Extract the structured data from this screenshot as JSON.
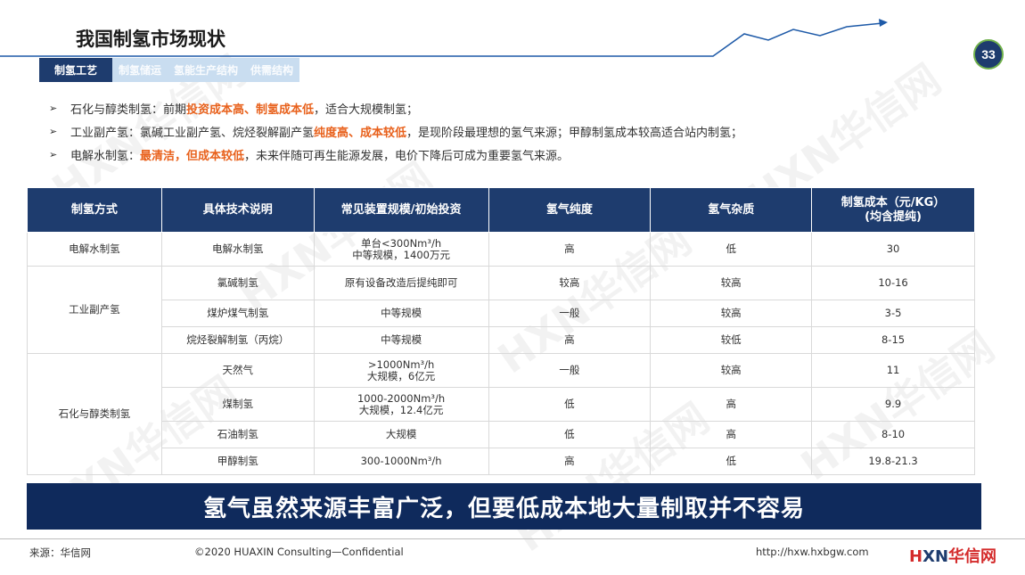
{
  "title": "我国制氢市场现状",
  "page_number": "33",
  "tabs": [
    {
      "label": "制氢工艺",
      "active": true
    },
    {
      "label": "制氢储运",
      "active": false
    },
    {
      "label": "氢能生产结构",
      "active": false
    },
    {
      "label": "供需结构",
      "active": false
    }
  ],
  "bullets": [
    {
      "pre": "石化与醇类制氢：前期",
      "hl1": "投资成本高、制氢成本低",
      "mid": "，适合大规模制氢；",
      "hl2": "",
      "post": ""
    },
    {
      "pre": "工业副产氢：氯碱工业副产氢、烷烃裂解副产氢",
      "hl1": "纯度高、成本较低",
      "mid": "，是现阶段最理想的氢气来源；甲醇制氢成本较高适合站内制氢；",
      "hl2": "",
      "post": ""
    },
    {
      "pre": "电解水制氢：",
      "hl1": "最清洁，但成本较低",
      "mid": "，未来伴随可再生能源发展，电价下降后可成为重要氢气来源。",
      "hl2": "",
      "post": ""
    }
  ],
  "table": {
    "headers": [
      "制氢方式",
      "具体技术说明",
      "常见装置规模/初始投资",
      "氢气纯度",
      "氢气杂质",
      "制氢成本（元/KG）",
      "(均含提纯)"
    ],
    "groups": [
      {
        "method": "电解水制氢",
        "rows": [
          {
            "tech": "电解水制氢",
            "scale1": "单台<300Nm³/h",
            "scale2": "中等规模，1400万元",
            "purity": "高",
            "impurity": "低",
            "cost": "30"
          }
        ]
      },
      {
        "method": "工业副产氢",
        "rows": [
          {
            "tech": "氯碱制氢",
            "scale1": "原有设备改造后提纯即可",
            "scale2": "",
            "purity": "较高",
            "impurity": "较高",
            "cost": "10-16"
          },
          {
            "tech": "煤炉煤气制氢",
            "scale1": "中等规模",
            "scale2": "",
            "purity": "一般",
            "impurity": "较高",
            "cost": "3-5"
          },
          {
            "tech": "烷烃裂解制氢（丙烷）",
            "scale1": "中等规模",
            "scale2": "",
            "purity": "高",
            "impurity": "较低",
            "cost": "8-15"
          }
        ]
      },
      {
        "method": "石化与醇类制氢",
        "rows": [
          {
            "tech": "天然气",
            "scale1": ">1000Nm³/h",
            "scale2": "大规模，6亿元",
            "purity": "一般",
            "impurity": "较高",
            "cost": "11"
          },
          {
            "tech": "煤制氢",
            "scale1": "1000-2000Nm³/h",
            "scale2": "大规模，12.4亿元",
            "purity": "低",
            "impurity": "高",
            "cost": "9.9"
          },
          {
            "tech": "石油制氢",
            "scale1": "大规模",
            "scale2": "",
            "purity": "低",
            "impurity": "高",
            "cost": "8-10"
          },
          {
            "tech": "甲醇制氢",
            "scale1": "300-1000Nm³/h",
            "scale2": "",
            "purity": "高",
            "impurity": "低",
            "cost": "19.8-21.3"
          }
        ]
      }
    ]
  },
  "banner": "氢气虽然来源丰富广泛，但要低成本地大量制取并不容易",
  "footer": {
    "source": "来源：华信网",
    "copyright": "©2020 HUAXIN Consulting—Confidential",
    "url": "http://hxw.hxbgw.com",
    "logo_h": "H",
    "logo_xn": "XN",
    "logo_cn": "华信网"
  },
  "colors": {
    "navy": "#1e3c6e",
    "orange": "#e8611c",
    "banner": "#0f2a5c",
    "tab_inactive": "#c9ddf0"
  }
}
